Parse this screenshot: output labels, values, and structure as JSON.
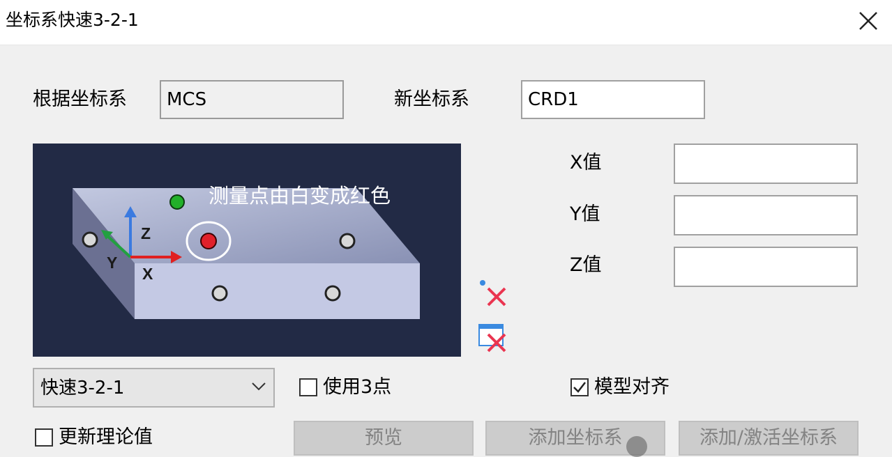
{
  "window": {
    "title": "坐标系快速3-2-1",
    "close_icon": "close-icon"
  },
  "form": {
    "base_coord_label": "根据坐标系",
    "base_coord_value": "MCS",
    "new_coord_label": "新坐标系",
    "new_coord_value": "CRD1",
    "x_label": "X值",
    "x_value": "",
    "y_label": "Y值",
    "y_value": "",
    "z_label": "Z值",
    "z_value": ""
  },
  "diagram": {
    "note": "测量点由白变成红色",
    "axis_labels": {
      "x": "X",
      "y": "Y",
      "z": "Z"
    },
    "colors": {
      "background": "#222a45",
      "point_active": "#e0202a",
      "point_green": "#22b02a",
      "point_default": "#d8d8d8",
      "axis_x": "#e02020",
      "axis_y": "#22a040",
      "axis_z": "#3a7ae0"
    }
  },
  "side_icons": [
    "delete-point-icon",
    "delete-all-icon"
  ],
  "mode_select": {
    "selected": "快速3-2-1"
  },
  "options": {
    "use_3_points_label": "使用3点",
    "use_3_points_checked": false,
    "model_align_label": "模型对齐",
    "model_align_checked": true,
    "update_theoretical_label": "更新理论值",
    "update_theoretical_checked": false
  },
  "buttons": {
    "preview": "预览",
    "add_coord": "添加坐标系",
    "add_activate_coord": "添加/激活坐标系"
  }
}
